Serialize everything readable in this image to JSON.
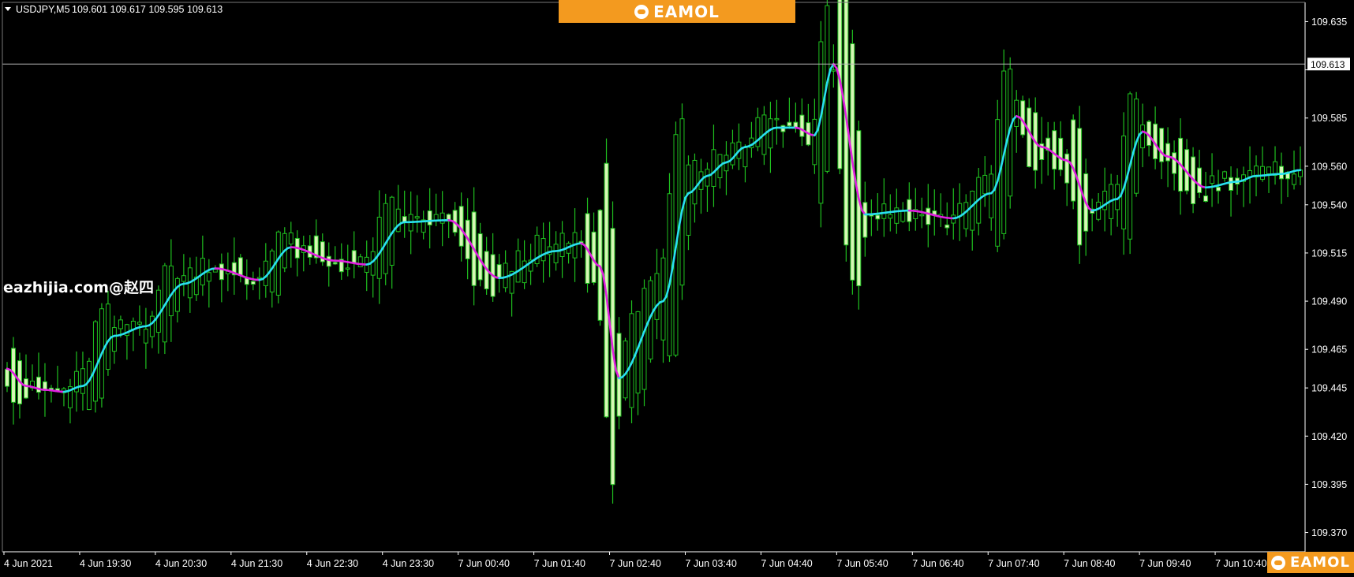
{
  "header": {
    "symbol": "USDJPY,M5",
    "ohlc": "109.601 109.617 109.595 109.613"
  },
  "brand": {
    "top_label": "EAMOL",
    "bottom_label": "EAMOL"
  },
  "watermark": "eazhijia.com@赵四",
  "colors": {
    "background": "#000000",
    "candle_wick": "#1fbf1f",
    "bull_candle": "#000000",
    "bear_candle": "#d7f7b5",
    "ma_up": "#29e0ef",
    "ma_down": "#e020e0",
    "price_line": "#b8b8b8",
    "axis": "#ffffff",
    "label_text": "#ffffff"
  },
  "chart_data": {
    "type": "candlestick",
    "instrument": "USDJPY",
    "timeframe": "M5",
    "current_price": 109.613,
    "current_price_label": "109.613",
    "ylim": [
      109.36,
      109.645
    ],
    "y_ticks": [
      109.635,
      109.61,
      109.585,
      109.56,
      109.54,
      109.515,
      109.49,
      109.465,
      109.445,
      109.42,
      109.395,
      109.37
    ],
    "y_tick_labels": [
      "109.635",
      "109.610",
      "109.585",
      "109.560",
      "109.540",
      "109.515",
      "109.490",
      "109.465",
      "109.445",
      "109.420",
      "109.395",
      "109.370"
    ],
    "x_ticks": [
      {
        "label": "4 Jun 2021",
        "index": 0
      },
      {
        "label": "4 Jun 19:30",
        "index": 12
      },
      {
        "label": "4 Jun 20:30",
        "index": 24
      },
      {
        "label": "4 Jun 21:30",
        "index": 36
      },
      {
        "label": "4 Jun 22:30",
        "index": 48
      },
      {
        "label": "4 Jun 23:30",
        "index": 60
      },
      {
        "label": "7 Jun 00:40",
        "index": 72
      },
      {
        "label": "7 Jun 01:40",
        "index": 84
      },
      {
        "label": "7 Jun 02:40",
        "index": 96
      },
      {
        "label": "7 Jun 03:40",
        "index": 108
      },
      {
        "label": "7 Jun 04:40",
        "index": 120
      },
      {
        "label": "7 Jun 05:40",
        "index": 132
      },
      {
        "label": "7 Jun 06:40",
        "index": 144
      },
      {
        "label": "7 Jun 07:40",
        "index": 156
      },
      {
        "label": "7 Jun 08:40",
        "index": 168
      },
      {
        "label": "7 Jun 09:40",
        "index": 180
      },
      {
        "label": "7 Jun 10:40",
        "index": 192
      }
    ],
    "candle_count": 206,
    "ma_anchors": [
      [
        0,
        109.455
      ],
      [
        3,
        109.446
      ],
      [
        6,
        109.444
      ],
      [
        9,
        109.443
      ],
      [
        12,
        109.446
      ],
      [
        17,
        109.472
      ],
      [
        22,
        109.477
      ],
      [
        28,
        109.499
      ],
      [
        33,
        109.507
      ],
      [
        40,
        109.501
      ],
      [
        45,
        109.518
      ],
      [
        52,
        109.511
      ],
      [
        57,
        109.509
      ],
      [
        63,
        109.531
      ],
      [
        70,
        109.532
      ],
      [
        78,
        109.502
      ],
      [
        87,
        109.516
      ],
      [
        91,
        109.52
      ],
      [
        94,
        109.508
      ],
      [
        97,
        109.45
      ],
      [
        104,
        109.49
      ],
      [
        108,
        109.546
      ],
      [
        111,
        109.555
      ],
      [
        114,
        109.562
      ],
      [
        117,
        109.57
      ],
      [
        122,
        109.58
      ],
      [
        125,
        109.58
      ],
      [
        128,
        109.576
      ],
      [
        131,
        109.613
      ],
      [
        136,
        109.535
      ],
      [
        143,
        109.537
      ],
      [
        150,
        109.533
      ],
      [
        156,
        109.546
      ],
      [
        160,
        109.586
      ],
      [
        164,
        109.57
      ],
      [
        168,
        109.563
      ],
      [
        172,
        109.537
      ],
      [
        176,
        109.543
      ],
      [
        180,
        109.578
      ],
      [
        184,
        109.565
      ],
      [
        190,
        109.549
      ],
      [
        195,
        109.552
      ],
      [
        198,
        109.555
      ],
      [
        202,
        109.556
      ],
      [
        205,
        109.558
      ]
    ]
  }
}
